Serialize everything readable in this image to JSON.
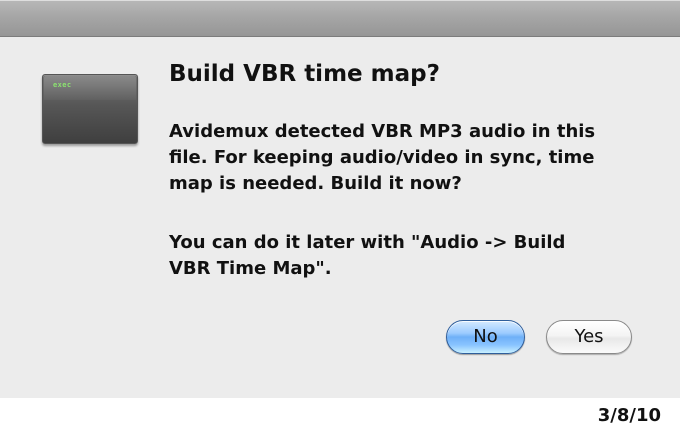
{
  "dialog": {
    "icon": {
      "name": "exec-icon",
      "label": "exec"
    },
    "title": "Build VBR time map?",
    "message": "Avidemux detected VBR MP3 audio in this\nfile. For keeping audio/video in sync, time\nmap is needed. Build it now?",
    "note": "You can do it later with \"Audio -> Build\nVBR Time Map\".",
    "buttons": {
      "no": "No",
      "yes": "Yes"
    }
  },
  "footer": {
    "date": "3/8/10"
  },
  "colors": {
    "dialog_background": "#ececec",
    "default_button": "#89c4ff",
    "icon_text": "#8be36f"
  }
}
